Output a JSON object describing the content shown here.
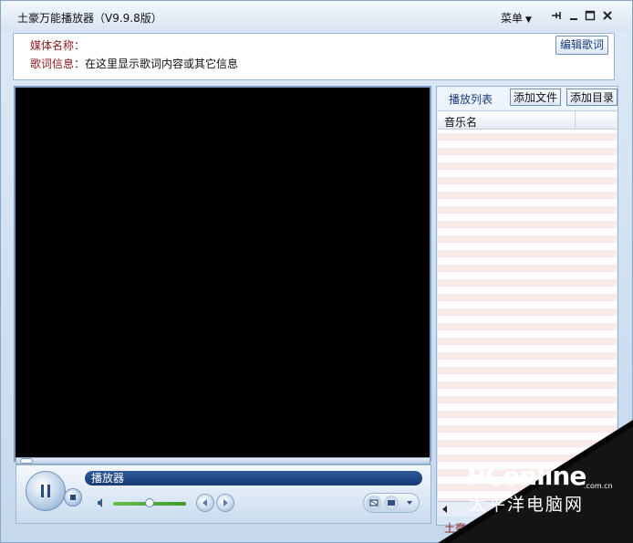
{
  "app": {
    "title": "土豪万能播放器（V9.9.8版）",
    "menu_label": "菜单",
    "menu_arrow": "▼"
  },
  "titlebar_icons": [
    "pin-icon",
    "minimize-icon",
    "maximize-icon",
    "close-icon"
  ],
  "info": {
    "media_label": "媒体名称：",
    "media_value": "",
    "lyrics_label": "歌词信息：",
    "lyrics_value": "在这里显示歌词内容或其它信息",
    "edit_button": "编辑歌词"
  },
  "player": {
    "status_text": "播放器",
    "volume_level": 0.5
  },
  "playlist": {
    "tab_label": "播放列表",
    "add_file_button": "添加文件",
    "add_folder_button": "添加目录",
    "column_header": "音乐名",
    "bottom_text": "土豪"
  },
  "watermark": {
    "logo": "PConline",
    "domain": ".com.cn",
    "chinese": "太平洋电脑网"
  }
}
